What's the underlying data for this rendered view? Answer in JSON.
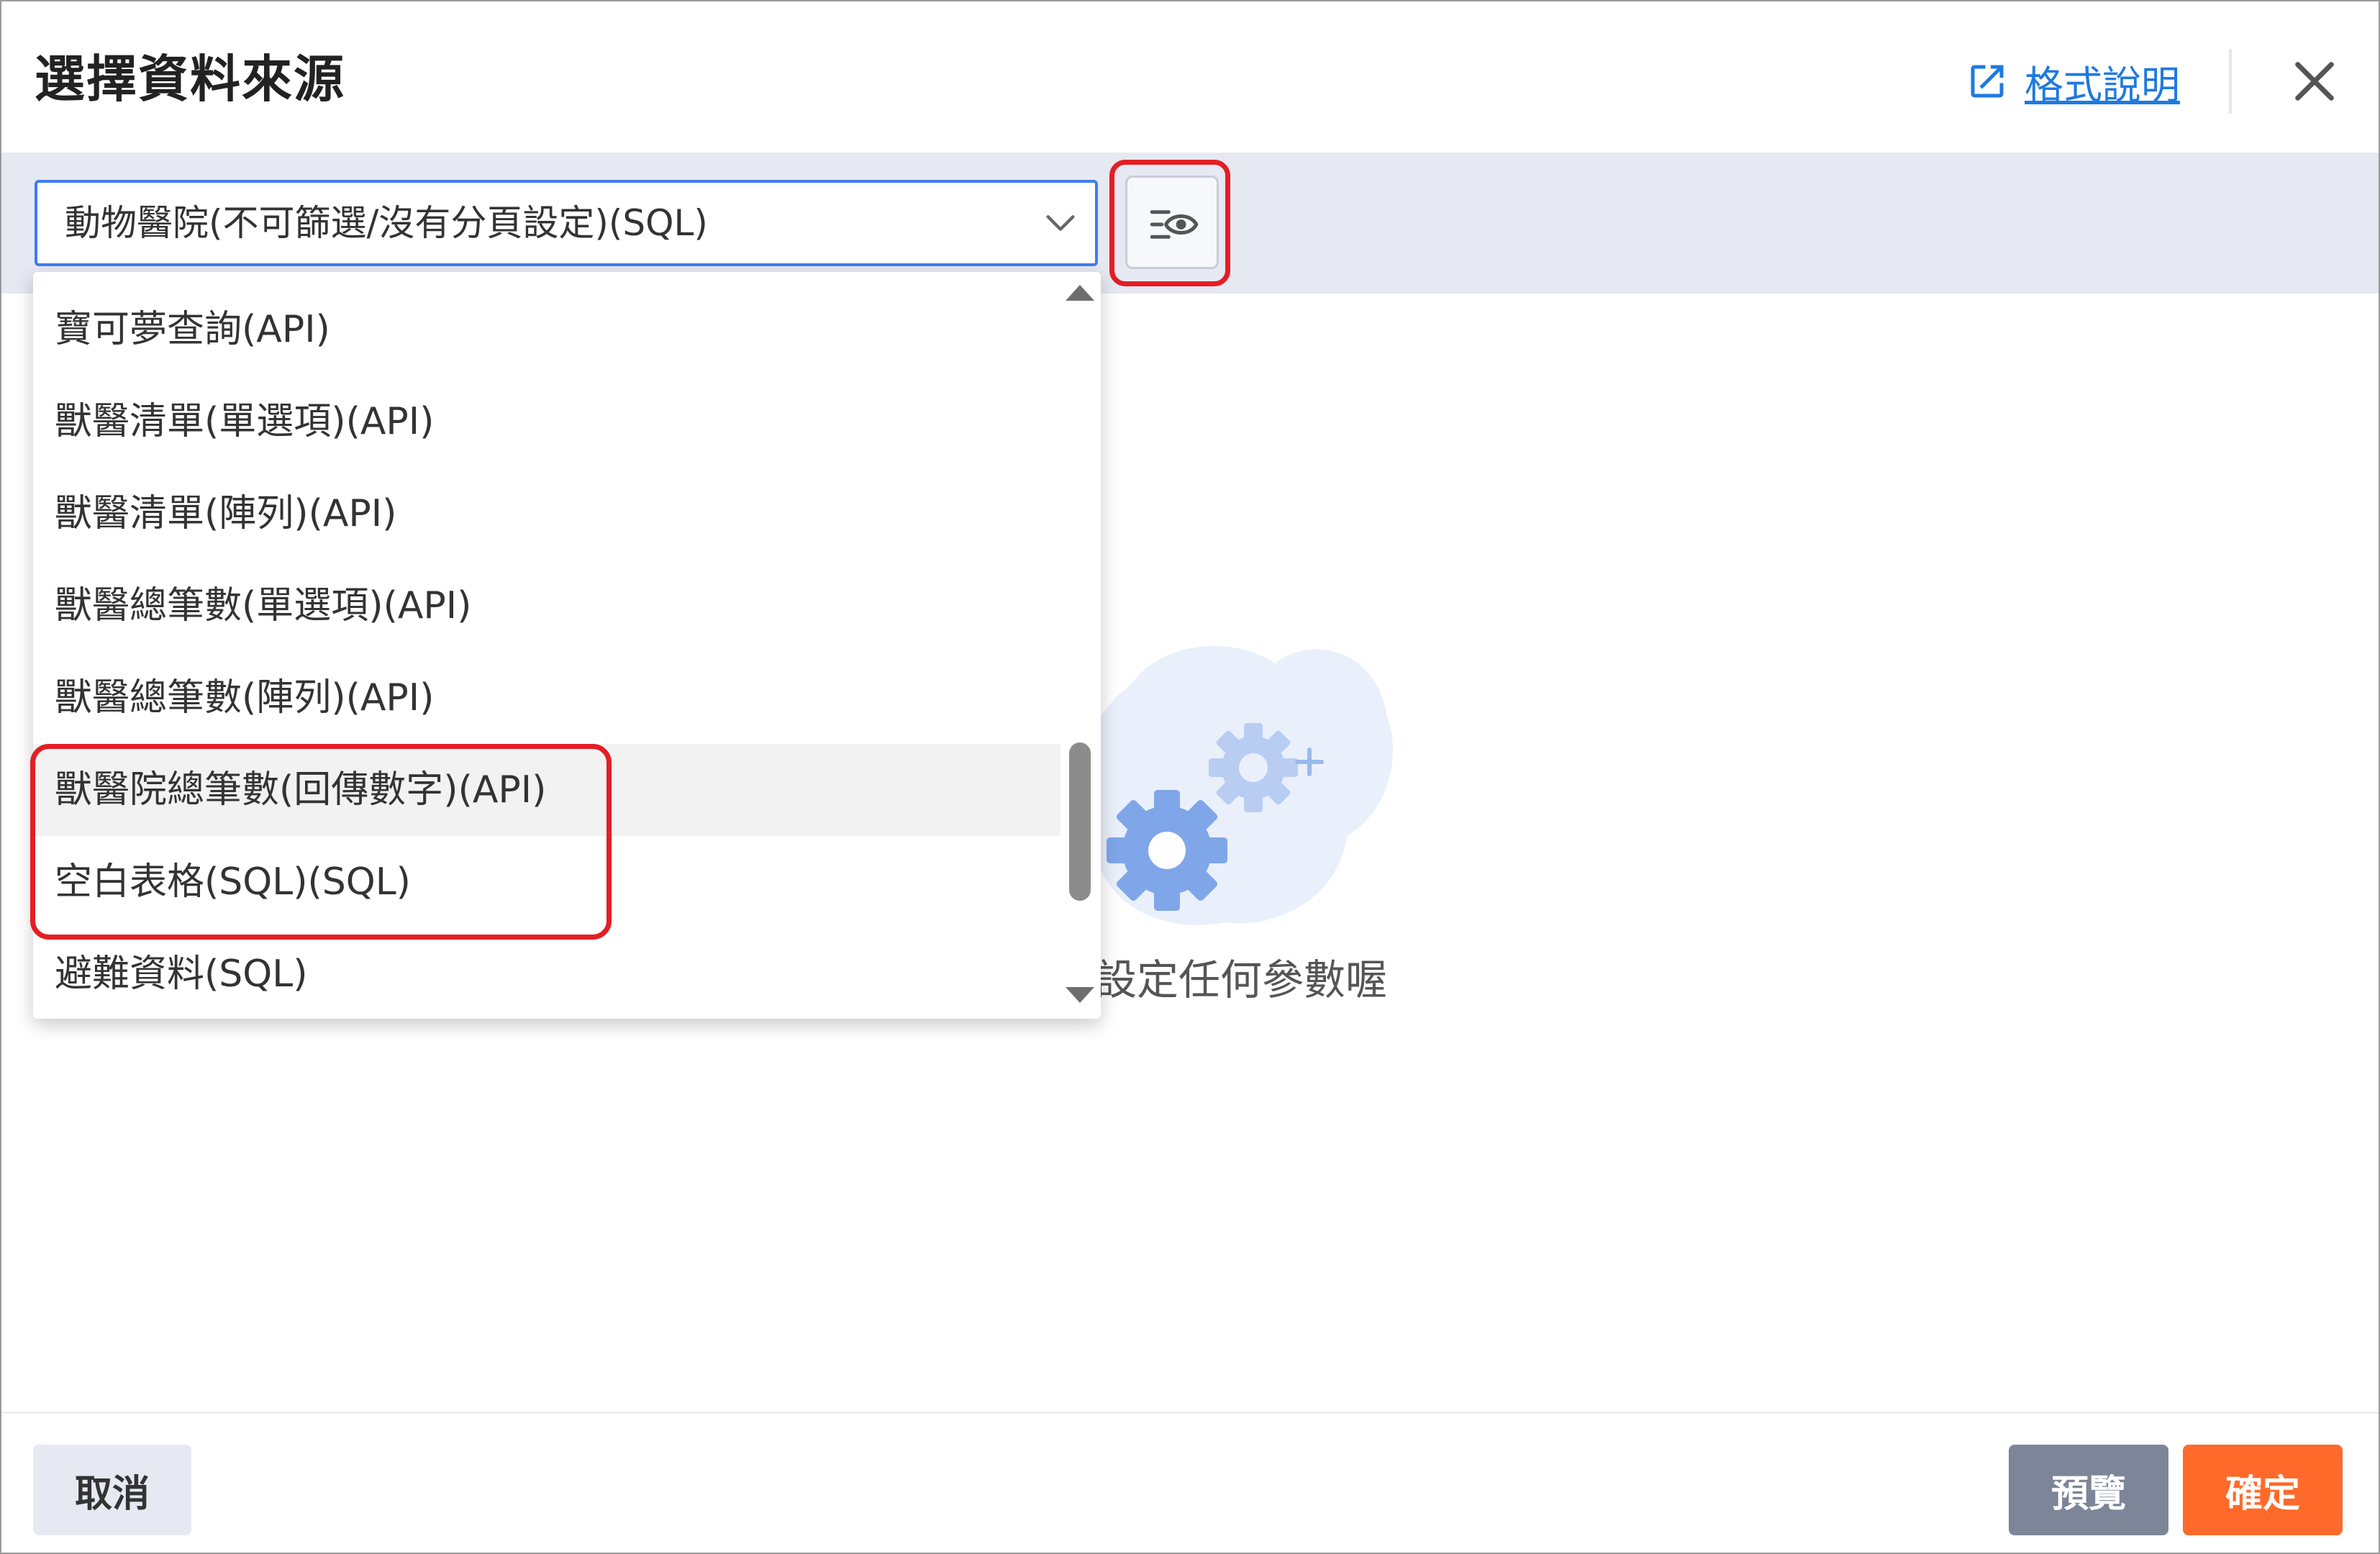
{
  "dialog": {
    "title": "選擇資料來源",
    "help_link_label": "格式說明"
  },
  "toolbar": {
    "selected_source": "動物醫院(不可篩選/沒有分頁設定)(SQL)"
  },
  "dropdown": {
    "options": [
      "寶可夢查詢(API)",
      "獸醫清單(單選項)(API)",
      "獸醫清單(陣列)(API)",
      "獸醫總筆數(單選項)(API)",
      "獸醫總筆數(陣列)(API)",
      "獸醫院總筆數(回傳數字)(API)",
      "空白表格(SQL)(SQL)",
      "避難資料(SQL)"
    ],
    "hovered_index": 5
  },
  "empty_state": {
    "message": "設定任何參數喔"
  },
  "footer": {
    "cancel_label": "取消",
    "preview_label": "預覽",
    "confirm_label": "確定"
  },
  "colors": {
    "accent": "#3d7df0",
    "link": "#1f7ae0",
    "confirm": "#ff6a2a",
    "preview": "#7c8698",
    "annotation": "#e41e25",
    "toolbar_bg": "#e6e9f1"
  },
  "icons": {
    "help": "external-link-icon",
    "close": "close-icon",
    "select": "chevron-down-icon",
    "preview_fields": "list-eye-icon",
    "empty": "gears-icon"
  }
}
